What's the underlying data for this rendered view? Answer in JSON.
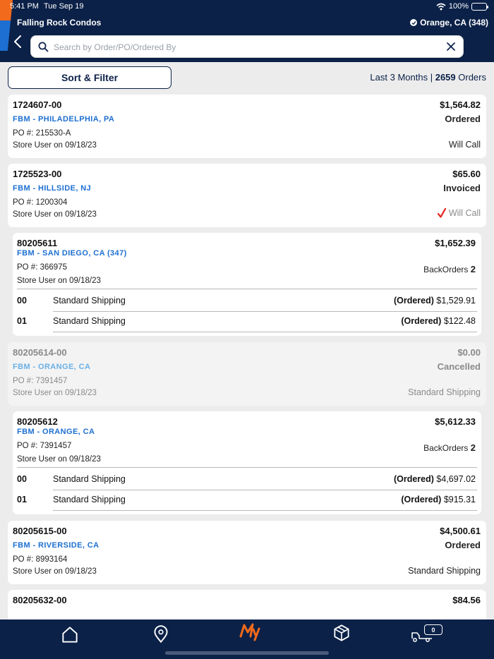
{
  "status_bar": {
    "time": "5:41 PM",
    "date": "Tue Sep 19",
    "battery": "100%"
  },
  "header": {
    "title": "Falling Rock Condos",
    "location": "Orange, CA (348)"
  },
  "search": {
    "placeholder": "Search by Order/PO/Ordered By"
  },
  "toolbar": {
    "sort_label": "Sort & Filter",
    "range": "Last 3 Months",
    "count": "2659",
    "count_suffix": "Orders"
  },
  "orders": [
    {
      "number": "1724607-00",
      "branch": "FBM - PHILADELPHIA, PA",
      "po": "PO #: 215530-A",
      "user": "Store User on 09/18/23",
      "amount": "$1,564.82",
      "status": "Ordered",
      "shipping": "Will Call"
    },
    {
      "number": "1725523-00",
      "branch": "FBM - HILLSIDE, NJ",
      "po": "PO #: 1200304",
      "user": "Store User on 09/18/23",
      "amount": "$65.60",
      "status": "Invoiced",
      "shipping": "Will Call"
    },
    {
      "number": "80205611",
      "branch": "FBM - SAN DIEGO, CA (347)",
      "po": "PO #: 366975",
      "user": "Store User on 09/18/23",
      "amount": "$1,652.39",
      "backorders_label": "BackOrders",
      "backorders_count": "2",
      "sub": [
        {
          "num": "00",
          "method": "Standard Shipping",
          "status": "(Ordered)",
          "amount": "$1,529.91"
        },
        {
          "num": "01",
          "method": "Standard Shipping",
          "status": "(Ordered)",
          "amount": "$122.48"
        }
      ]
    },
    {
      "number": "80205614-00",
      "branch": "FBM - ORANGE, CA",
      "po": "PO #: 7391457",
      "user": "Store User on 09/18/23",
      "amount": "$0.00",
      "status": "Cancelled",
      "shipping": "Standard Shipping"
    },
    {
      "number": "80205612",
      "branch": "FBM - ORANGE, CA",
      "po": "PO #: 7391457",
      "user": "Store User on 09/18/23",
      "amount": "$5,612.33",
      "backorders_label": "BackOrders",
      "backorders_count": "2",
      "sub": [
        {
          "num": "00",
          "method": "Standard Shipping",
          "status": "(Ordered)",
          "amount": "$4,697.02"
        },
        {
          "num": "01",
          "method": "Standard Shipping",
          "status": "(Ordered)",
          "amount": "$915.31"
        }
      ]
    },
    {
      "number": "80205615-00",
      "branch": "FBM - RIVERSIDE, CA",
      "po": "PO #: 8993164",
      "user": "Store User on 09/18/23",
      "amount": "$4,500.61",
      "status": "Ordered",
      "shipping": "Standard Shipping"
    },
    {
      "number": "80205632-00",
      "amount": "$84.56"
    }
  ],
  "bottom_nav": {
    "cart_count": "0",
    "items": [
      "home-icon",
      "location-pin-icon",
      "my-icon",
      "box-icon",
      "truck-icon"
    ]
  },
  "colors": {
    "navy": "#0b2148",
    "accent_orange": "#f26a1b",
    "link_blue": "#1d6fd1",
    "check_red": "#e2231a"
  }
}
